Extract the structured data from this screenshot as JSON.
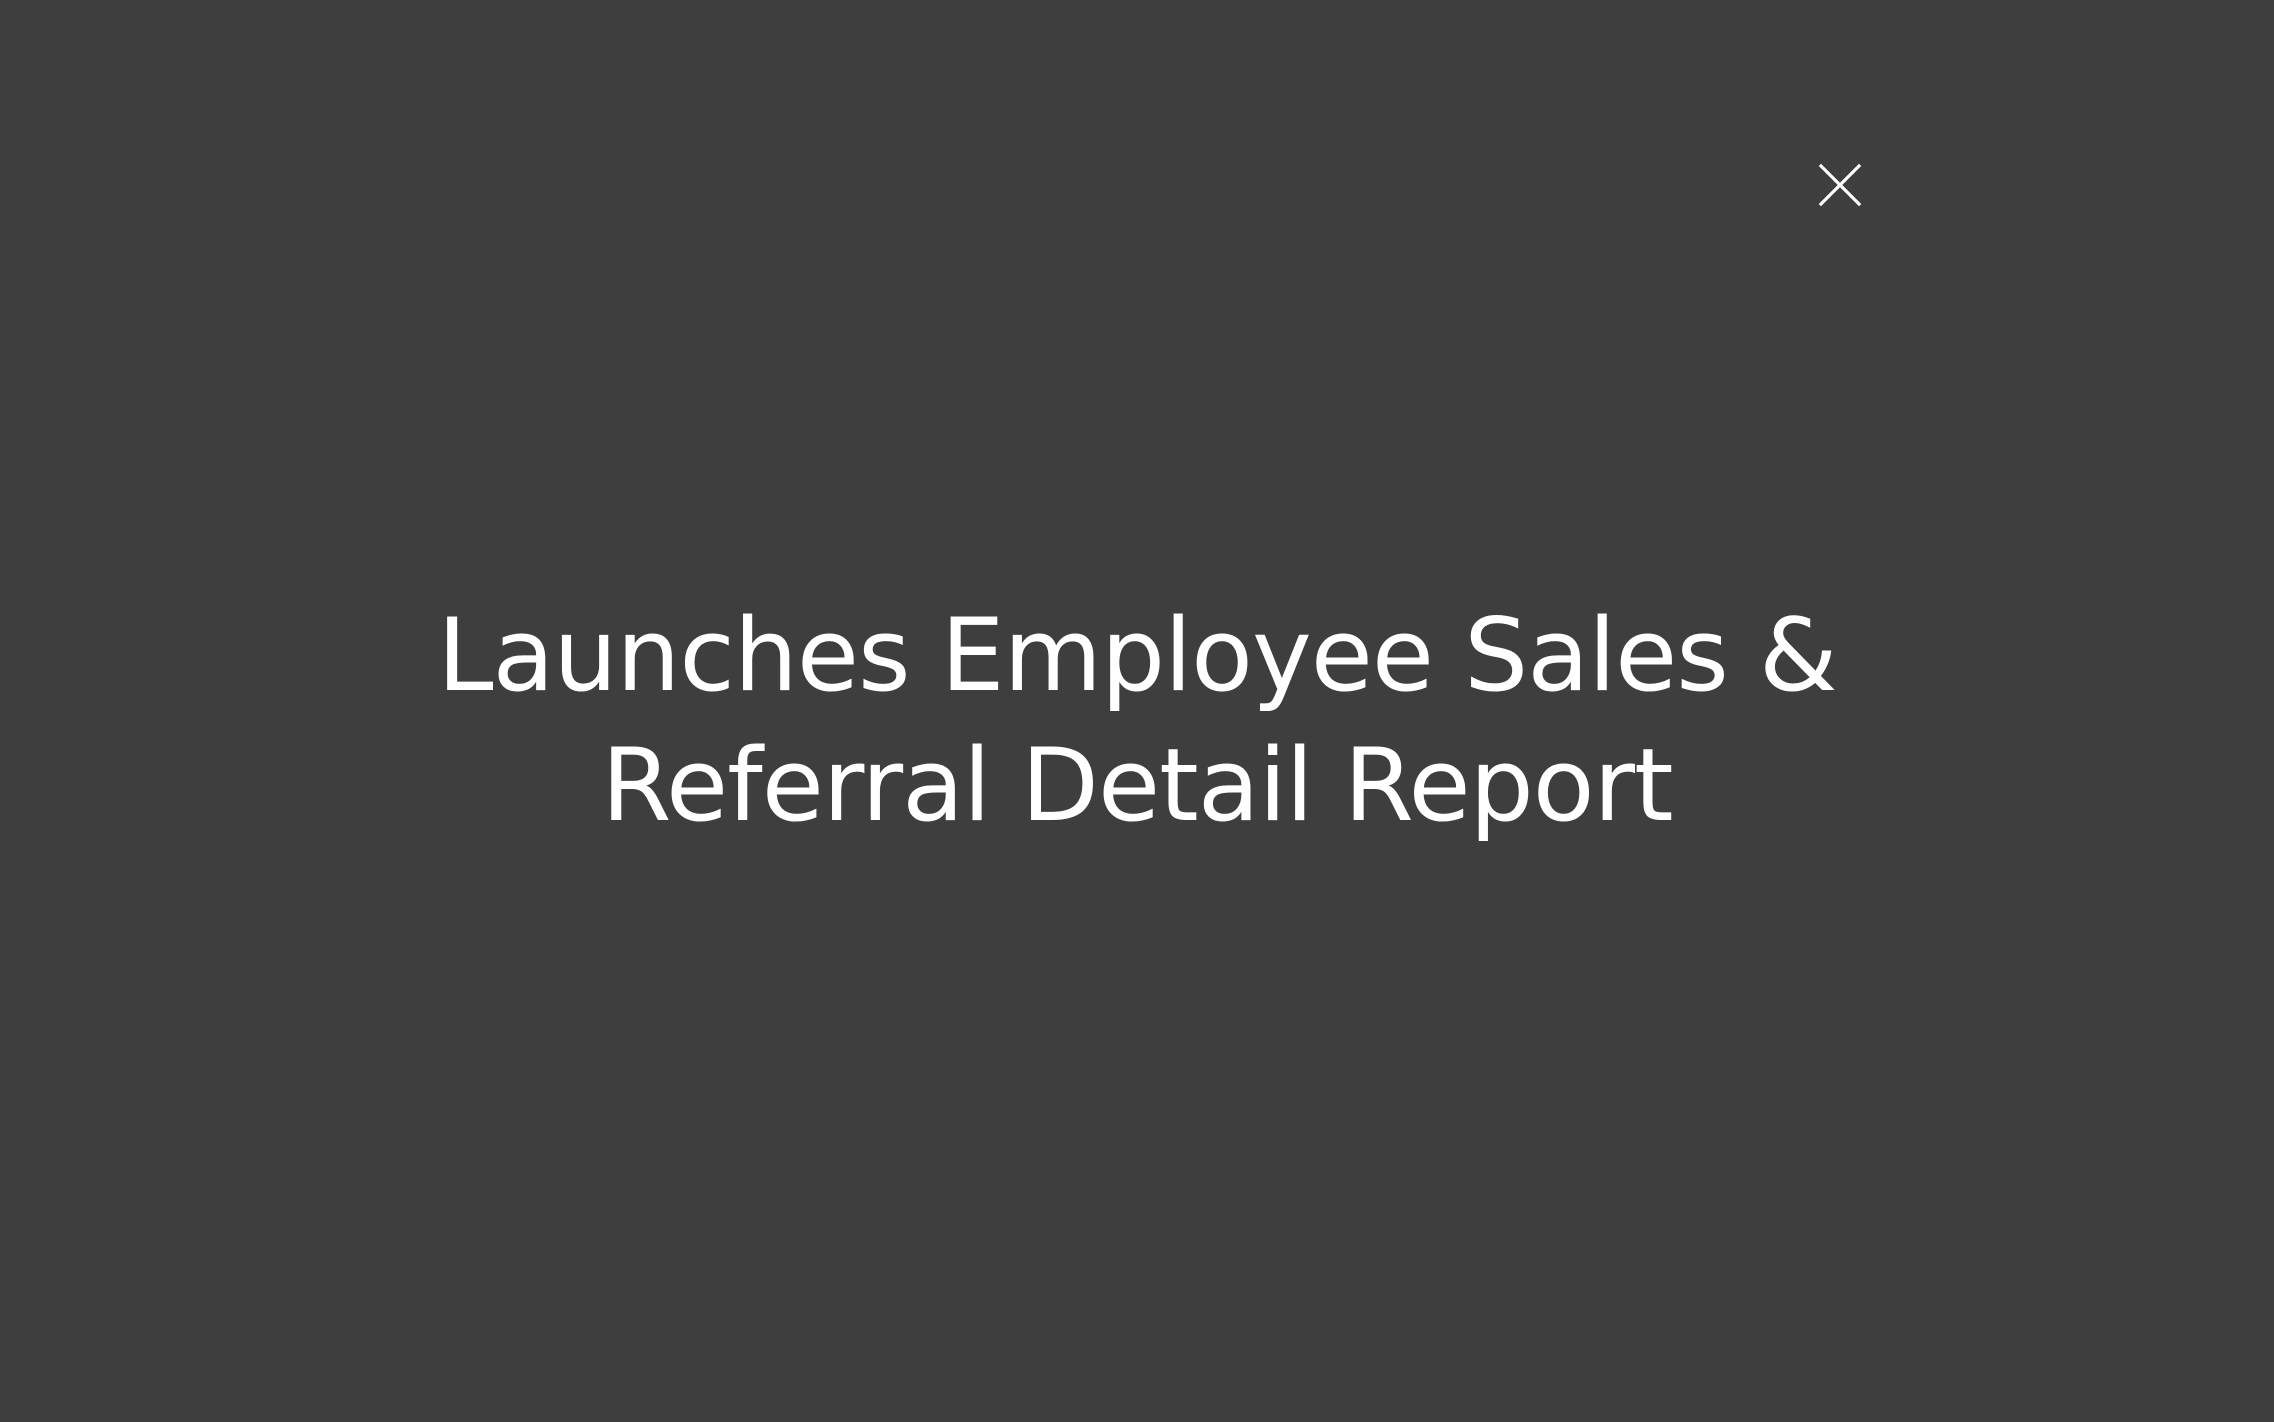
{
  "dialog": {
    "close_icon": "close-icon",
    "message_lines": [
      "Launches Employee Sales &",
      "Referral Detail Report"
    ]
  },
  "colors": {
    "background": "#3e3e3e",
    "text": "#ffffff"
  }
}
